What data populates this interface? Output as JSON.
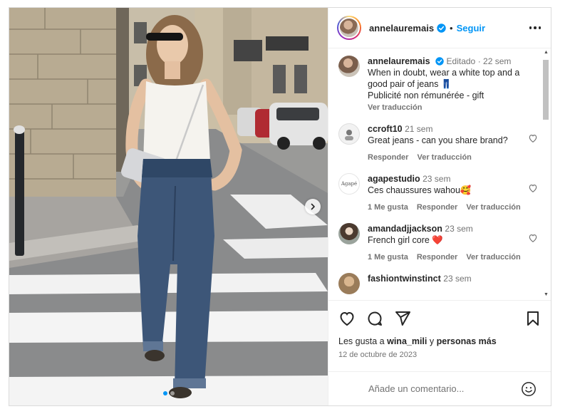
{
  "post": {
    "author": "annelauremais",
    "follow_label": "Seguir",
    "separator": "•",
    "caption": {
      "username": "annelauremais",
      "edited": "Editado",
      "time": "22 sem",
      "text_line1": "When in doubt, wear a white top and a",
      "text_line2": "good pair of jeans 👖",
      "text_line3": "Publicité non rémunérée - gift",
      "translate": "Ver traducción"
    },
    "comments": [
      {
        "username": "ccroft10",
        "time": "21 sem",
        "text": "Great jeans - can you share brand?",
        "likes": "",
        "reply": "Responder",
        "translate": "Ver traducción"
      },
      {
        "username": "agapestudio",
        "time": "23 sem",
        "text": "Ces chaussures wahou🥰",
        "likes": "1 Me gusta",
        "reply": "Responder",
        "translate": "Ver traducción"
      },
      {
        "username": "amandadjjackson",
        "time": "23 sem",
        "text": "French girl core ❤️",
        "likes": "1 Me gusta",
        "reply": "Responder",
        "translate": "Ver traducción"
      },
      {
        "username": "fashiontwinstinct",
        "time": "23 sem",
        "text": "",
        "likes": "",
        "reply": "",
        "translate": ""
      }
    ],
    "agape_avatar_text": "Agapé",
    "likes_prefix": "Les gusta a ",
    "likes_user": "wina_mili",
    "likes_middle": " y ",
    "likes_suffix": "personas más",
    "date": "12 de octubre de 2023",
    "add_comment_placeholder": "Añade un comentario...",
    "colors": {
      "accent": "#0095f6",
      "verified": "#0095f6",
      "text": "#262626",
      "muted": "#737373"
    },
    "icons": [
      "more-options-icon",
      "verified-badge-icon",
      "heart-icon",
      "comment-icon",
      "share-icon",
      "bookmark-icon",
      "emoji-icon",
      "next-arrow-icon"
    ]
  }
}
